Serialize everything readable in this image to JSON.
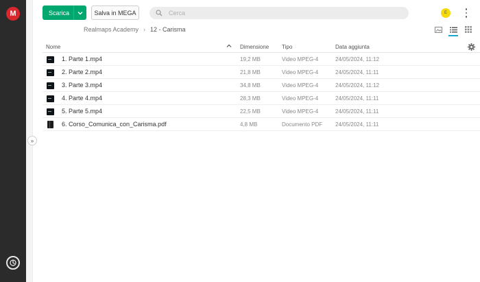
{
  "app": {
    "logo_letter": "M"
  },
  "toolbar": {
    "download_label": "Scarica",
    "save_label": "Salva in MEGA",
    "search_placeholder": "Cerca",
    "avatar_initial": "E"
  },
  "breadcrumb": {
    "parent": "Realmaps Academy",
    "current": "12 - Carisma"
  },
  "table": {
    "headers": {
      "name": "Nome",
      "size": "Dimensione",
      "type": "Tipo",
      "date": "Data aggiunta"
    },
    "rows": [
      {
        "name": "1. Parte 1.mp4",
        "size": "19,2 MB",
        "type": "Video MPEG-4",
        "date": "24/05/2024, 11:12",
        "icon": "video-thumbnail"
      },
      {
        "name": "2. Parte 2.mp4",
        "size": "21,8 MB",
        "type": "Video MPEG-4",
        "date": "24/05/2024, 11:11",
        "icon": "video-thumbnail"
      },
      {
        "name": "3. Parte 3.mp4",
        "size": "34,8 MB",
        "type": "Video MPEG-4",
        "date": "24/05/2024, 11:12",
        "icon": "video-thumbnail"
      },
      {
        "name": "4. Parte 4.mp4",
        "size": "28,3 MB",
        "type": "Video MPEG-4",
        "date": "24/05/2024, 11:11",
        "icon": "video-thumbnail"
      },
      {
        "name": "5. Parte 5.mp4",
        "size": "22,5 MB",
        "type": "Video MPEG-4",
        "date": "24/05/2024, 11:11",
        "icon": "video-thumbnail"
      },
      {
        "name": "6. Corso_Comunica_con_Carisma.pdf",
        "size": "4,8 MB",
        "type": "Documento PDF",
        "date": "24/05/2024, 11:11",
        "icon": "pdf-thumbnail"
      }
    ]
  },
  "colors": {
    "brand": "#d9272e",
    "download": "#00a870",
    "sidebar": "#2b2b2b",
    "active_view": "#1aa8c9",
    "avatar": "#f5d90a"
  }
}
